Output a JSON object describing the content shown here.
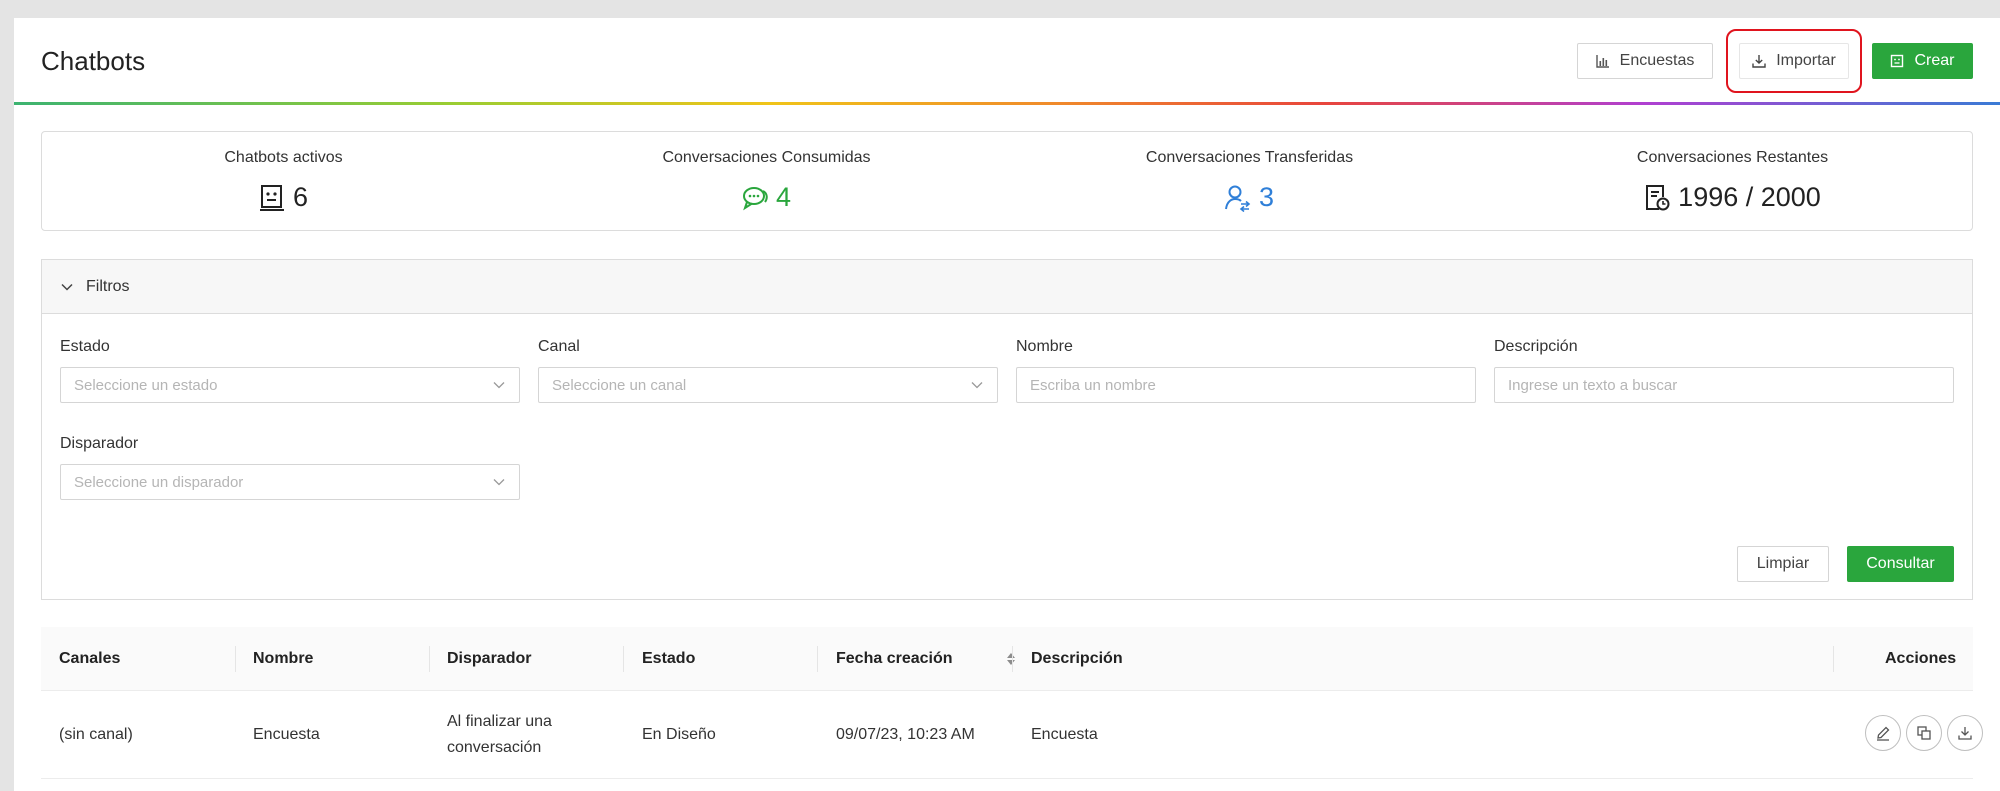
{
  "header": {
    "title": "Chatbots",
    "buttons": {
      "encuestas": "Encuestas",
      "importar": "Importar",
      "crear": "Crear"
    }
  },
  "stats": [
    {
      "label": "Chatbots activos",
      "value": "6",
      "icon": "robot-icon",
      "color": "#222222"
    },
    {
      "label": "Conversaciones Consumidas",
      "value": "4",
      "icon": "chat-bubbles-icon",
      "color": "#2aa63d"
    },
    {
      "label": "Conversaciones Transferidas",
      "value": "3",
      "icon": "user-transfer-icon",
      "color": "#2f7fd8"
    },
    {
      "label": "Conversaciones Restantes",
      "value": "1996 / 2000",
      "icon": "document-clock-icon",
      "color": "#222222"
    }
  ],
  "filters": {
    "title": "Filtros",
    "estado": {
      "label": "Estado",
      "placeholder": "Seleccione un estado"
    },
    "canal": {
      "label": "Canal",
      "placeholder": "Seleccione un canal"
    },
    "nombre": {
      "label": "Nombre",
      "placeholder": "Escriba un nombre"
    },
    "descripcion": {
      "label": "Descripción",
      "placeholder": "Ingrese un texto a buscar"
    },
    "disparador": {
      "label": "Disparador",
      "placeholder": "Seleccione un disparador"
    },
    "limpiar": "Limpiar",
    "consultar": "Consultar"
  },
  "table": {
    "columns": {
      "canales": "Canales",
      "nombre": "Nombre",
      "disparador": "Disparador",
      "estado": "Estado",
      "fecha": "Fecha creación",
      "descripcion": "Descripción",
      "acciones": "Acciones"
    },
    "rows": [
      {
        "canales": "(sin canal)",
        "nombre": "Encuesta",
        "disparador_line1": "Al finalizar una",
        "disparador_line2": "conversación",
        "estado": "En Diseño",
        "fecha": "09/07/23, 10:23 AM",
        "descripcion": "Encuesta"
      }
    ]
  },
  "colors": {
    "accent": "#2aa63d",
    "highlight": "#e0141e",
    "blue": "#2f7fd8"
  }
}
